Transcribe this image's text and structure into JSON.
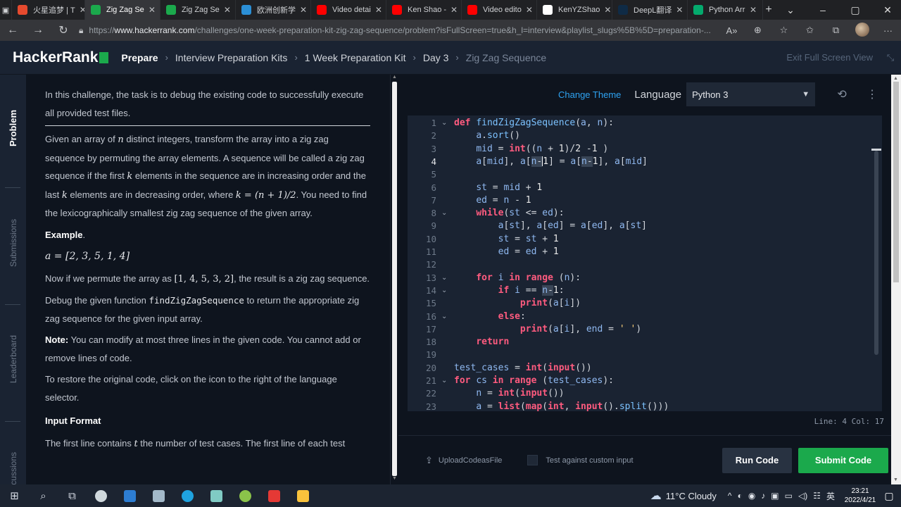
{
  "browser": {
    "tabs": [
      {
        "label": "火星追梦 | T",
        "color": "#e64a2e",
        "active": false
      },
      {
        "label": "Zig Zag Se",
        "color": "#1ba94c",
        "active": true
      },
      {
        "label": "Zig Zag Se",
        "color": "#1ba94c",
        "active": false
      },
      {
        "label": "欧洲创新学",
        "color": "#2b8fd6",
        "active": false
      },
      {
        "label": "Video detai",
        "color": "#ff0000",
        "active": false
      },
      {
        "label": "Ken Shao -",
        "color": "#ff0000",
        "active": false
      },
      {
        "label": "Video edito",
        "color": "#ff0000",
        "active": false
      },
      {
        "label": "KenYZShao",
        "color": "#ffffff",
        "active": false
      },
      {
        "label": "DeepL翻译",
        "color": "#0f2b46",
        "active": false
      },
      {
        "label": "Python Arr",
        "color": "#04aa6d",
        "active": false
      }
    ],
    "new_tab": "+",
    "url_prefix": "https://",
    "url_host": "www.hackerrank.com",
    "url_path": "/challenges/one-week-preparation-kit-zig-zag-sequence/problem?isFullScreen=true&h_l=interview&playlist_slugs%5B%5D=preparation-..."
  },
  "header": {
    "logo": "HackerRank",
    "breadcrumb": [
      "Prepare",
      "Interview Preparation Kits",
      "1 Week Preparation Kit",
      "Day 3",
      "Zig Zag Sequence"
    ],
    "exit_fullscreen": "Exit Full Screen View"
  },
  "vtabs": [
    "Problem",
    "Submissions",
    "Leaderboard",
    "Discussions"
  ],
  "problem": {
    "intro": "In this challenge, the task is to debug the existing code to successfully execute all provided test files.",
    "p1a": "Given an array of ",
    "n": "n",
    "p1b": " distinct integers, transform the array into a zig zag sequence by permuting the array elements. A sequence will be called a zig zag sequence if the first ",
    "k": "k",
    "p1c": " elements in the sequence are in increasing order and the last ",
    "p1d": " elements are in decreasing order, where ",
    "k_formula": "k = (n + 1)/2",
    "p1e": ". You need to find the lexicographically smallest zig zag sequence of the given array.",
    "example_label": "Example",
    "example_dot": ".",
    "example_a": "a = [2, 3, 5, 1, 4]",
    "permute_a": "Now if we permute the array as ",
    "permute_arr": "[1, 4, 5, 3, 2]",
    "permute_b": ", the result is a zig zag sequence.",
    "debug_a": "Debug the given function ",
    "debug_fn": "findZigZagSequence",
    "debug_b": " to return the appropriate zig zag sequence for the given input array.",
    "note_label": "Note:",
    "note_text": " You can modify at most three lines in the given code. You cannot add or remove lines of code.",
    "restore": "To restore the original code, click on the icon to the right of the language selector.",
    "input_format": "Input Format",
    "input_a": "The first line contains ",
    "t": "t",
    "input_b": " the number of test cases. The first line of each test"
  },
  "editor": {
    "change_theme": "Change Theme",
    "language_label": "Language",
    "language": "Python 3",
    "status": "Line: 4 Col: 17",
    "line_numbers": [
      "1",
      "2",
      "3",
      "4",
      "5",
      "6",
      "7",
      "8",
      "9",
      "10",
      "11",
      "12",
      "13",
      "14",
      "15",
      "16",
      "17",
      "18",
      "19",
      "20",
      "21",
      "22",
      "23"
    ],
    "current_line": 4
  },
  "footer": {
    "upload": "UploadCodeasFile",
    "custom_input": "Test against custom input",
    "run": "Run Code",
    "submit": "Submit Code"
  },
  "taskbar": {
    "weather": "11°C  Cloudy",
    "ime": "英",
    "time": "23:21",
    "date": "2022/4/21"
  }
}
